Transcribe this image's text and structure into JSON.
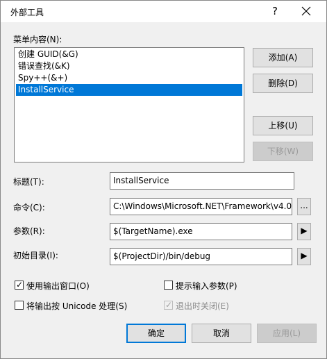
{
  "window": {
    "title": "外部工具",
    "help_symbol": "?",
    "close_symbol": "✕"
  },
  "menu": {
    "label": "菜单内容(N):",
    "items": [
      {
        "label": "创建 GUID(&G)"
      },
      {
        "label": "错误查找(&K)"
      },
      {
        "label": "Spy++(&+)"
      },
      {
        "label": "InstallService"
      }
    ]
  },
  "buttons": {
    "add": "添加(A)",
    "delete": "删除(D)",
    "move_up": "上移(U)",
    "move_down": "下移(W)",
    "ok": "确定",
    "cancel": "取消",
    "apply": "应用(L)"
  },
  "fields": {
    "title": {
      "label": "标题(T):",
      "value": "InstallService"
    },
    "command": {
      "label": "命令(C):",
      "value": "C:\\Windows\\Microsoft.NET\\Framework\\v4.0",
      "browse": "..."
    },
    "args": {
      "label": "参数(R):",
      "value": "$(TargetName).exe",
      "arrow": "▶"
    },
    "init_dir": {
      "label": "初始目录(I):",
      "value": "$(ProjectDir)/bin/debug",
      "arrow": "▶"
    }
  },
  "checkboxes": {
    "use_output": {
      "label": "使用输出窗口(O)",
      "checked": true
    },
    "prompt_args": {
      "label": "提示输入参数(P)",
      "checked": false
    },
    "unicode": {
      "label": "将输出按 Unicode 处理(S)",
      "checked": false
    },
    "close_on_exit": {
      "label": "退出时关闭(E)",
      "checked": true,
      "disabled": true
    }
  },
  "glyphs": {
    "check": "✓"
  },
  "colors": {
    "selection": "#0078d7",
    "default_button_border": "#0078d7"
  }
}
